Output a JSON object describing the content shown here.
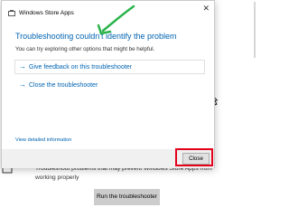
{
  "settings_page": {
    "back_glyph": "←",
    "description": "Troubleshoot problems that may prevent Windows Store Apps from working properly",
    "run_button": "Run the troubleshooter",
    "icon": "store-app-icon"
  },
  "dialog": {
    "title": "Windows Store Apps",
    "title_icon": "store-app-icon",
    "close_glyph": "✕",
    "heading": "Troubleshooting couldn't identify the problem",
    "subtext": "You can try exploring other options that might be helpful.",
    "options": [
      {
        "arrow": "→",
        "label": "Give feedback on this troubleshooter"
      },
      {
        "arrow": "→",
        "label": "Close the troubleshooter"
      }
    ],
    "detail_link": "View detailed information",
    "close_button": "Close"
  },
  "annotations": {
    "arrow_color": "#2bb34a",
    "highlight_color": "#e3001b"
  },
  "colors": {
    "accent": "#0063b1",
    "footer": "#f0f0f0",
    "button": "#e1e1e1"
  }
}
